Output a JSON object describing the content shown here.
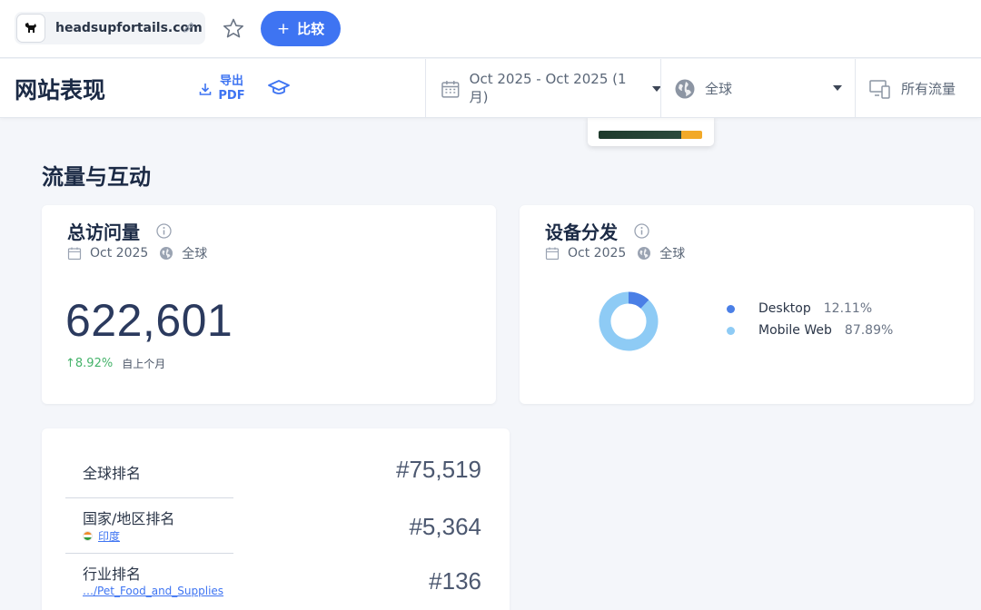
{
  "topbar": {
    "site_logo": "dog-logo-icon",
    "site_name": "headsupfortails.com",
    "compare_label": "比较"
  },
  "header": {
    "title": "网站表现",
    "export_label": "导出PDF",
    "date_range": "Oct 2025 - Oct 2025 (1 月)",
    "geo": "全球",
    "traffic": "所有流量"
  },
  "section": {
    "title": "流量与互动"
  },
  "visits_card": {
    "title": "总访问量",
    "date": "Oct 2025",
    "geo": "全球",
    "value": "622,601",
    "change": "8.92%",
    "change_label": "自上个月"
  },
  "device_card": {
    "title": "设备分发",
    "date": "Oct 2025",
    "geo": "全球",
    "items": [
      {
        "label": "Desktop",
        "pct": "12.11%",
        "value": 12.11,
        "color": "#4a7fe6"
      },
      {
        "label": "Mobile Web",
        "pct": "87.89%",
        "value": 87.89,
        "color": "#8ecbf5"
      }
    ]
  },
  "rank_card": {
    "rows": [
      {
        "label": "全球排名",
        "value": "#75,519"
      },
      {
        "label": "国家/地区排名",
        "sub": "印度",
        "value": "#5,364"
      },
      {
        "label": "行业排名",
        "sub": "…/Pet_Food_and_Supplies",
        "value": "#136"
      }
    ]
  },
  "colors": {
    "accent": "#3e74f2",
    "positive": "#45b36a"
  }
}
